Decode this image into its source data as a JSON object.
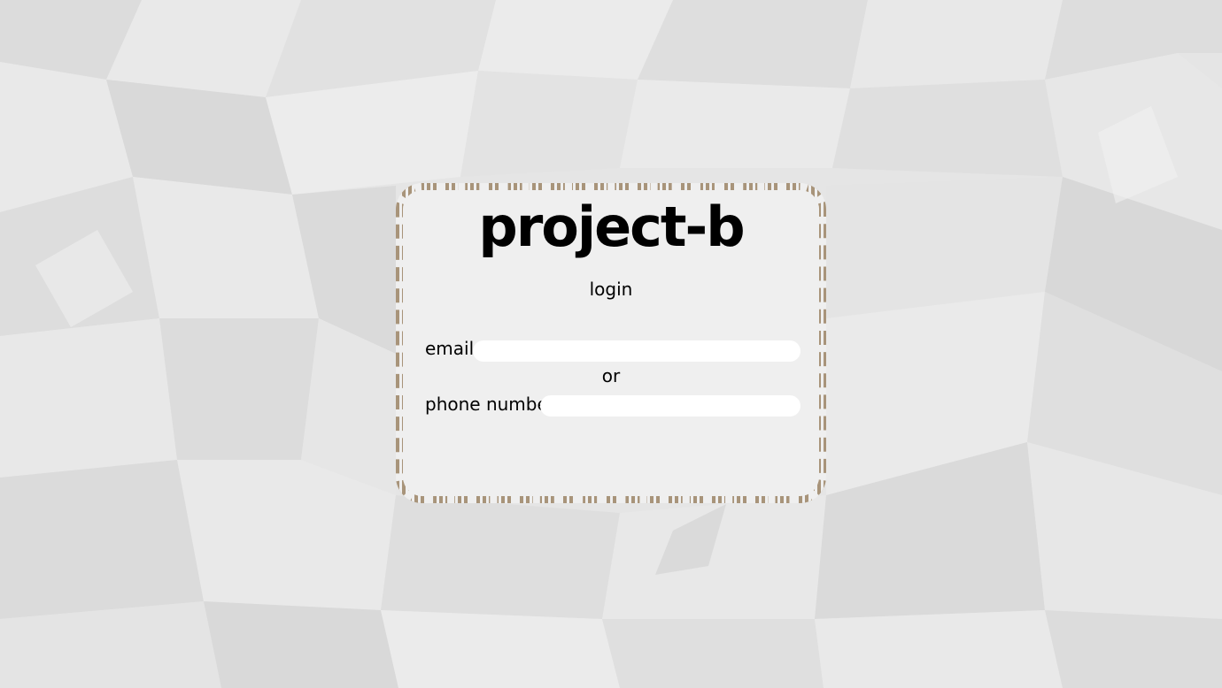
{
  "brand": {
    "title": "project-b"
  },
  "login_form": {
    "heading": "login",
    "email_label": "email",
    "email_value": "",
    "separator": "or",
    "phone_label": "phone number",
    "phone_value": ""
  },
  "colors": {
    "background": "#e6e6e6",
    "card": "#efefef",
    "card_border": "#a8947a",
    "input": "#ffffff"
  }
}
